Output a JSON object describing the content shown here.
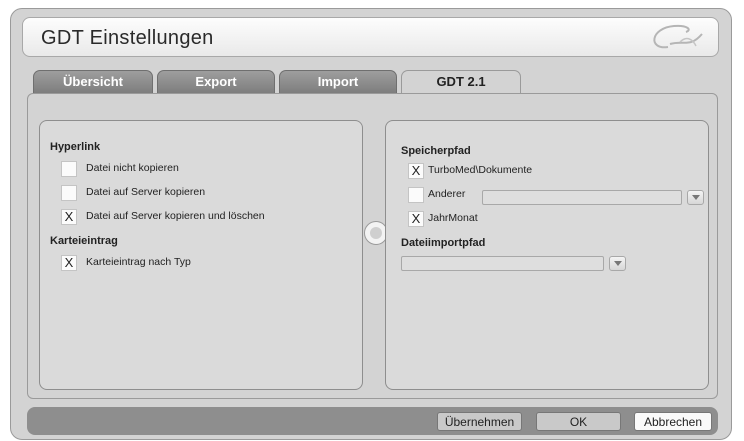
{
  "window": {
    "title": "GDT Einstellungen"
  },
  "tabs": [
    {
      "label": "Übersicht"
    },
    {
      "label": "Export"
    },
    {
      "label": "Import"
    },
    {
      "label": "GDT 2.1",
      "active": true
    }
  ],
  "left_panel": {
    "hyperlink": {
      "title": "Hyperlink",
      "options": [
        {
          "label": "Datei nicht kopieren",
          "mark": ""
        },
        {
          "label": "Datei auf Server kopieren",
          "mark": ""
        },
        {
          "label": "Datei auf Server kopieren und löschen",
          "mark": "X"
        }
      ]
    },
    "karteieintrag": {
      "title": "Karteieintrag",
      "options": [
        {
          "label": "Karteieintrag nach Typ",
          "mark": "X"
        }
      ]
    }
  },
  "right_panel": {
    "speicherpfad": {
      "title": "Speicherpfad",
      "options": [
        {
          "label": "TurboMed\\Dokumente",
          "mark": "X"
        },
        {
          "label": "Anderer",
          "mark": ""
        },
        {
          "label": "JahrMonat",
          "mark": "X"
        }
      ],
      "anderer_value": ""
    },
    "dateiimportpfad": {
      "title": "Dateiimportpfad",
      "value": ""
    }
  },
  "buttons": {
    "uebernehmen": "Übernehmen",
    "ok": "OK",
    "abbrechen": "Abbrechen"
  }
}
